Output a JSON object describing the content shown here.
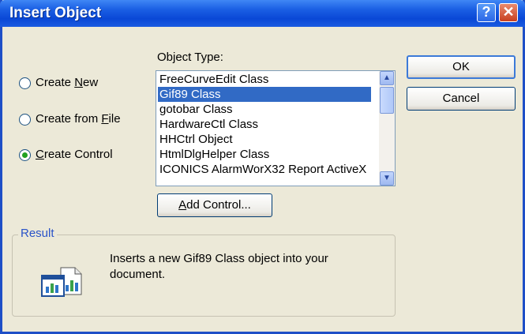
{
  "window": {
    "title": "Insert Object"
  },
  "titlebar": {
    "help_glyph": "?",
    "close_glyph": "✕"
  },
  "options": [
    {
      "label": "Create New",
      "accel": "N",
      "selected": false
    },
    {
      "label": "Create from File",
      "accel": "F",
      "selected": false
    },
    {
      "label": "Create Control",
      "accel": "C",
      "selected": true
    }
  ],
  "object_type": {
    "label": "Object Type:",
    "items": [
      "FreeCurveEdit Class",
      "Gif89 Class",
      "gotobar Class",
      "HardwareCtl Class",
      "HHCtrl Object",
      "HtmlDlgHelper Class",
      "ICONICS AlarmWorX32 Report ActiveX"
    ],
    "selected_index": 1
  },
  "buttons": {
    "ok": "OK",
    "cancel": "Cancel",
    "add_control": "Add Control..."
  },
  "result": {
    "label": "Result",
    "text": "Inserts a new Gif89 Class object into your document."
  },
  "colors": {
    "title_bar": "#0a48d6",
    "selection": "#316ac5",
    "radio_dot": "#21a121",
    "group_label": "#2a53c8"
  }
}
